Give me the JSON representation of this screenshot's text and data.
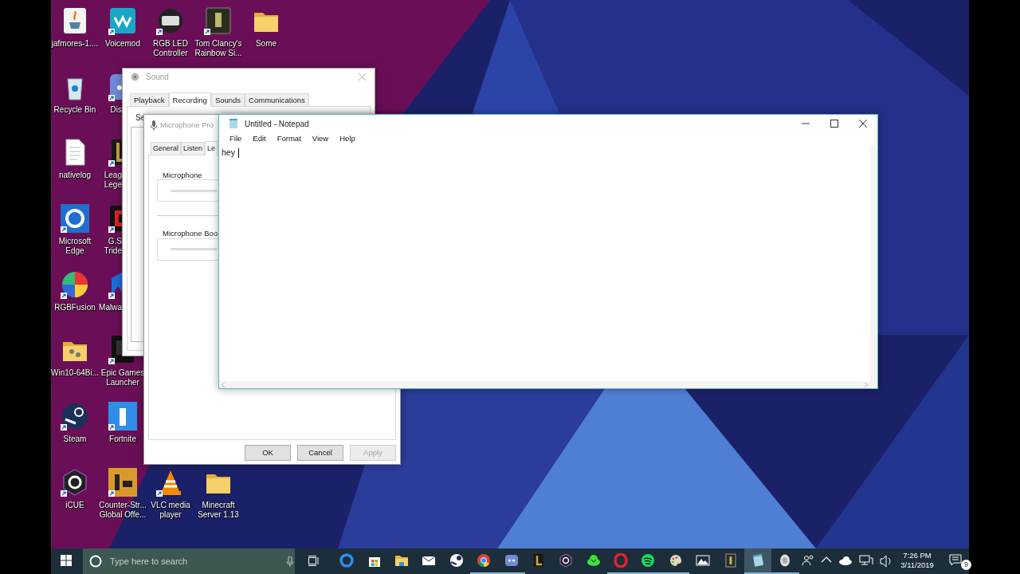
{
  "desktop_icons": [
    {
      "label_lines": [
        "jafmores-1...."
      ],
      "kind": "full"
    },
    {
      "label_lines": [
        "Voicemod"
      ],
      "kind": "full"
    },
    {
      "label_lines": [
        "RGB LED",
        "Controller"
      ],
      "kind": "full"
    },
    {
      "label_lines": [
        "Tom Clancy's",
        "Rainbow Si..."
      ],
      "kind": "full"
    },
    {
      "label_lines": [
        "Some"
      ],
      "kind": "full"
    },
    {
      "label_lines": [
        "Recycle Bin"
      ],
      "kind": "full"
    },
    {
      "label_lines": [
        "Dis"
      ],
      "kind": "covered"
    },
    {
      "label_lines": [
        "nativelog"
      ],
      "kind": "full"
    },
    {
      "label_lines": [
        "Leag",
        "Lege"
      ],
      "kind": "covered"
    },
    {
      "label_lines": [
        "Microsoft",
        "Edge"
      ],
      "kind": "full"
    },
    {
      "label_lines": [
        "G.S",
        "Tride"
      ],
      "kind": "covered"
    },
    {
      "label_lines": [
        "RGBFusion"
      ],
      "kind": "full"
    },
    {
      "label_lines": [
        "Malwa"
      ],
      "kind": "covered"
    },
    {
      "label_lines": [
        "Win10-64Bi..."
      ],
      "kind": "full"
    },
    {
      "label_lines": [
        "Epic Games",
        "Launcher"
      ],
      "kind": "full"
    },
    {
      "label_lines": [
        "Steam"
      ],
      "kind": "full"
    },
    {
      "label_lines": [
        "Fortnite"
      ],
      "kind": "full"
    },
    {
      "label_lines": [
        "iCUE"
      ],
      "kind": "full"
    },
    {
      "label_lines": [
        "Counter-Str...",
        "Global Offe..."
      ],
      "kind": "full"
    },
    {
      "label_lines": [
        "VLC media",
        "player"
      ],
      "kind": "full"
    },
    {
      "label_lines": [
        "Minecraft",
        "Server 1.13"
      ],
      "kind": "full"
    }
  ],
  "sound_window": {
    "title": "Sound",
    "tabs": [
      {
        "label": "Playback",
        "selected": false
      },
      {
        "label": "Recording",
        "selected": true
      },
      {
        "label": "Sounds",
        "selected": false
      },
      {
        "label": "Communications",
        "selected": false
      }
    ],
    "instruction": "Se"
  },
  "microphone_properties": {
    "title": "Microphone Pro",
    "tabs": [
      {
        "label": "General",
        "selected": false
      },
      {
        "label": "Listen",
        "selected": false
      },
      {
        "label": "Le",
        "selected": true
      }
    ],
    "groups": [
      {
        "label": "Microphone"
      },
      {
        "label": "Microphone Boo"
      }
    ],
    "buttons": [
      {
        "label": "OK",
        "disabled": false
      },
      {
        "label": "Cancel",
        "disabled": false
      },
      {
        "label": "Apply",
        "disabled": true
      }
    ]
  },
  "notepad": {
    "title": "Untitled - Notepad",
    "menu": [
      "File",
      "Edit",
      "Format",
      "View",
      "Help"
    ],
    "text": "hey"
  },
  "taskbar": {
    "search": {
      "placeholder": "Type here to search"
    },
    "apps": [
      {
        "running": false,
        "selected": false
      },
      {
        "running": false,
        "selected": false
      },
      {
        "running": false,
        "selected": false
      },
      {
        "running": false,
        "selected": false
      },
      {
        "running": false,
        "selected": false
      },
      {
        "running": true,
        "selected": false
      },
      {
        "running": true,
        "selected": false
      },
      {
        "running": false,
        "selected": false
      },
      {
        "running": false,
        "selected": false
      },
      {
        "running": false,
        "selected": false
      },
      {
        "running": true,
        "selected": false
      },
      {
        "running": true,
        "selected": false
      },
      {
        "running": true,
        "selected": false
      },
      {
        "running": false,
        "selected": false
      },
      {
        "running": false,
        "selected": false
      },
      {
        "running": true,
        "selected": true
      },
      {
        "running": true,
        "selected": false
      }
    ],
    "clock": {
      "time": "7:26 PM",
      "date": "3/11/2019"
    },
    "notifications": {
      "count": "9"
    }
  }
}
